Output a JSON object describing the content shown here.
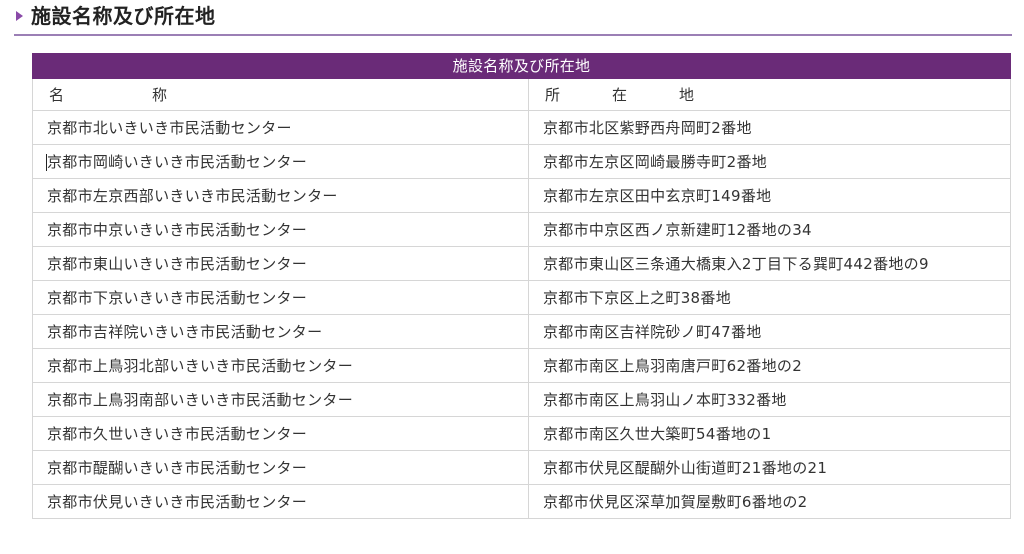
{
  "page": {
    "heading": "施設名称及び所在地"
  },
  "table": {
    "caption": "施設名称及び所在地",
    "headers": {
      "name": [
        "名",
        "称"
      ],
      "address": [
        "所",
        "在",
        "地"
      ]
    },
    "rows": [
      {
        "name": "京都市北いきいき市民活動センター",
        "address": "京都市北区紫野西舟岡町2番地"
      },
      {
        "name": "京都市岡崎いきいき市民活動センター",
        "address": "京都市左京区岡崎最勝寺町2番地"
      },
      {
        "name": "京都市左京西部いきいき市民活動センター",
        "address": "京都市左京区田中玄京町149番地"
      },
      {
        "name": "京都市中京いきいき市民活動センター",
        "address": "京都市中京区西ノ京新建町12番地の34"
      },
      {
        "name": "京都市東山いきいき市民活動センター",
        "address": "京都市東山区三条通大橋東入2丁目下る巽町442番地の9"
      },
      {
        "name": "京都市下京いきいき市民活動センター",
        "address": "京都市下京区上之町38番地"
      },
      {
        "name": "京都市吉祥院いきいき市民活動センター",
        "address": "京都市南区吉祥院砂ノ町47番地"
      },
      {
        "name": "京都市上鳥羽北部いきいき市民活動センター",
        "address": "京都市南区上鳥羽南唐戸町62番地の2"
      },
      {
        "name": "京都市上鳥羽南部いきいき市民活動センター",
        "address": "京都市南区上鳥羽山ノ本町332番地"
      },
      {
        "name": "京都市久世いきいき市民活動センター",
        "address": "京都市南区久世大築町54番地の1"
      },
      {
        "name": "京都市醍醐いきいき市民活動センター",
        "address": "京都市伏見区醍醐外山街道町21番地の21"
      },
      {
        "name": "京都市伏見いきいき市民活動センター",
        "address": "京都市伏見区深草加賀屋敷町6番地の2"
      }
    ]
  },
  "colors": {
    "accent": "#6a2b78",
    "marker": "#8a4aa8",
    "rule": "#9b7fb5",
    "border": "#d6d6d6"
  }
}
